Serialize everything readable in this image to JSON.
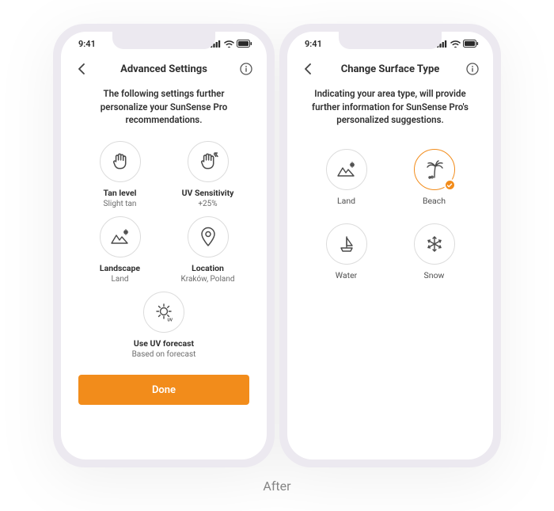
{
  "status": {
    "time": "9:41"
  },
  "left": {
    "title": "Advanced Settings",
    "intro": "The following settings further personalize your SunSense Pro recommendations.",
    "settings": [
      {
        "title": "Tan level",
        "value": "Slight tan"
      },
      {
        "title": "UV Sensitivity",
        "value": "+25%"
      },
      {
        "title": "Landscape",
        "value": "Land"
      },
      {
        "title": "Location",
        "value": "Kraków, Poland"
      },
      {
        "title": "Use UV forecast",
        "value": "Based on forecast"
      }
    ],
    "done_label": "Done"
  },
  "right": {
    "title": "Change Surface Type",
    "intro": "Indicating your area type, will provide further information for SunSense Pro's personalized suggestions.",
    "options": [
      {
        "label": "Land",
        "selected": false
      },
      {
        "label": "Beach",
        "selected": true
      },
      {
        "label": "Water",
        "selected": false
      },
      {
        "label": "Snow",
        "selected": false
      }
    ]
  },
  "caption": "After",
  "colors": {
    "accent": "#f28c1b"
  }
}
